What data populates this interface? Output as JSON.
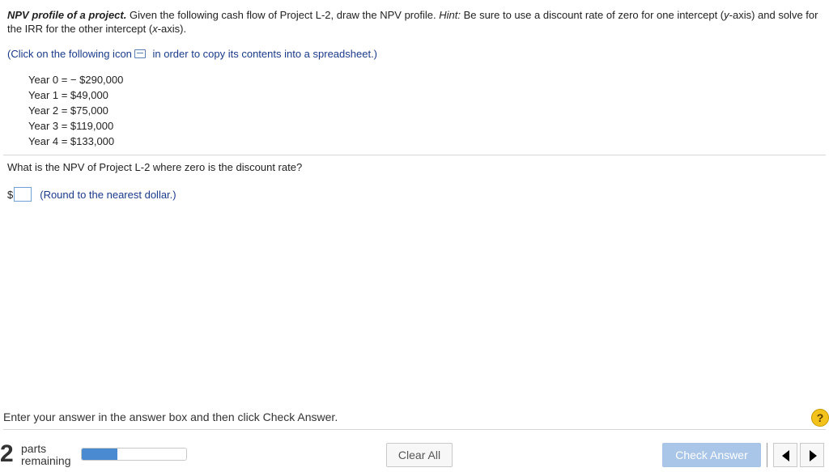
{
  "question": {
    "title_bold": "NPV profile of a project.",
    "text1": " Given the following cash flow of Project L-2, draw the NPV profile. ",
    "hint_label": "Hint:",
    "text2": " Be sure to use a discount rate of zero for one intercept (",
    "y_var": "y",
    "text3": "-axis) and solve for the IRR for the other intercept (",
    "x_var": "x",
    "text4": "-axis)."
  },
  "copy_note": {
    "before": "(Click on the following icon",
    "after": " in order to copy its contents into a spreadsheet.)",
    "icon": "spreadsheet-icon"
  },
  "cash_flows": [
    "Year 0 = − $290,000",
    "Year 1 = $49,000",
    "Year 2 = $75,000",
    "Year 3 = $119,000",
    "Year 4 = $133,000"
  ],
  "sub_question": "What is the NPV of Project L-2 where zero is the discount rate?",
  "answer": {
    "currency": "$",
    "value": "",
    "note": "(Round to the nearest dollar.)"
  },
  "footer": {
    "instruction": "Enter your answer in the answer box and then click Check Answer.",
    "help_symbol": "?",
    "parts_count": "2",
    "parts_label": "parts",
    "remaining_label": "remaining",
    "progress_fraction": 0.34,
    "clear_label": "Clear All",
    "check_label": "Check Answer"
  },
  "colors": {
    "link_blue": "#1a3a8a",
    "progress_blue": "#4a8ad0",
    "check_button_disabled": "#a9c6e8",
    "help_yellow": "#f3c21b"
  }
}
